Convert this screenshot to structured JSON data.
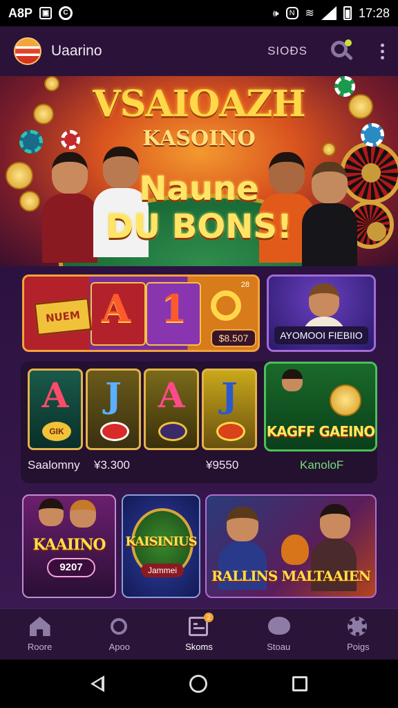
{
  "status_bar": {
    "left_text": "A8P",
    "time": "17:28"
  },
  "app_bar": {
    "title": "Uaarino",
    "link": "SIOÐS"
  },
  "hero": {
    "title": "VSAIOAZH",
    "subtitle": "KASOINO",
    "line1": "Naune",
    "line2": "DU BONS!"
  },
  "slot_card": {
    "badge": "NUEM",
    "reels": [
      "A",
      "1"
    ],
    "price": "$8.507",
    "corner": "28"
  },
  "host_card": {
    "label": "AYOMOOI FIEBIIO"
  },
  "row2": {
    "reels": [
      "A",
      "J",
      "A",
      "J"
    ],
    "chip_label": "GIK",
    "footer_name": "Saalomny",
    "footer_price1": "¥3.300",
    "footer_price2": "¥9550",
    "footer_right": "KanoloF"
  },
  "kaer_card": {
    "label": "KAGFF GAEINO"
  },
  "row3": {
    "kaalino_label": "KAAIINO",
    "kaalino_pill": "9207",
    "kasinius_label": "KAISINIUS",
    "kasinius_sub": "Jammei",
    "rallins_label": "RALLINS MALTAAIEN"
  },
  "bottom_nav": {
    "items": [
      {
        "label": "Roore",
        "icon": "home-icon"
      },
      {
        "label": "Apoo",
        "icon": "search-icon"
      },
      {
        "label": "Skoms",
        "icon": "slots-icon",
        "badge": "2"
      },
      {
        "label": "Stoau",
        "icon": "chat-icon"
      },
      {
        "label": "Poigs",
        "icon": "gear-icon"
      }
    ]
  },
  "colors": {
    "accent_gold": "#ffd84a",
    "bg_purple": "#2b1238",
    "nav_icon": "#8f7ca6"
  }
}
